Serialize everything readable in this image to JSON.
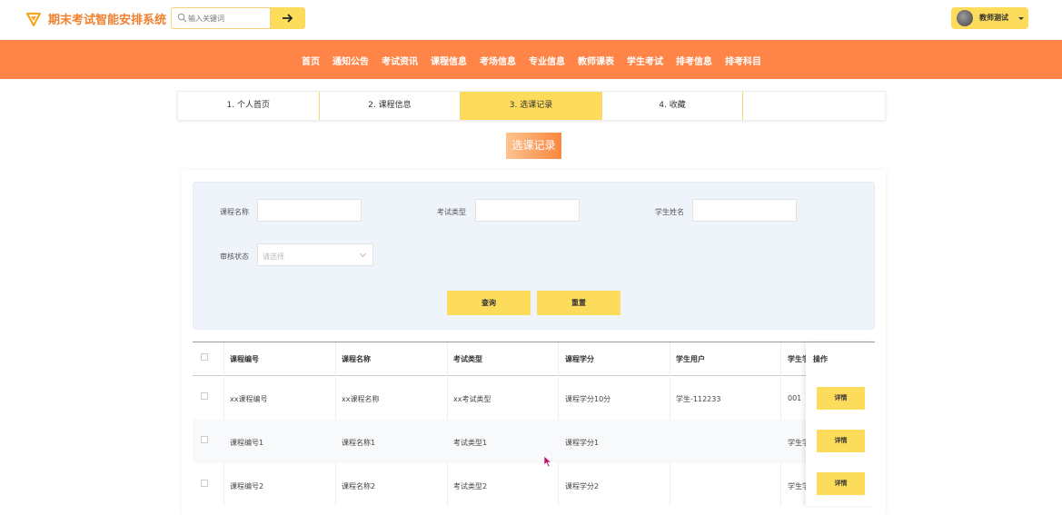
{
  "app": {
    "title": "期末考试智能安排系统"
  },
  "search": {
    "placeholder": "输入关键词"
  },
  "user": {
    "name": "教师测试"
  },
  "nav": {
    "items": [
      "首页",
      "通知公告",
      "考试资讯",
      "课程信息",
      "考场信息",
      "专业信息",
      "教师课表",
      "学生考试",
      "排考信息",
      "排考科目"
    ]
  },
  "steps": [
    {
      "label": "1. 个人首页"
    },
    {
      "label": "2. 课程信息"
    },
    {
      "label": "3. 选课记录"
    },
    {
      "label": "4. 收藏"
    },
    {
      "label": ""
    }
  ],
  "section": {
    "title": "选课记录"
  },
  "filter": {
    "course_name_label": "课程名称",
    "exam_type_label": "考试类型",
    "student_name_label": "学生姓名",
    "review_status_label": "审核状态",
    "review_status_placeholder": "请选择",
    "query_button": "查询",
    "reset_button": "重置"
  },
  "table": {
    "headers": [
      "课程编号",
      "课程名称",
      "考试类型",
      "课程学分",
      "学生用户",
      "学生学",
      "操作"
    ],
    "rows": [
      {
        "code": "xx课程编号",
        "name": "xx课程名称",
        "type": "xx考试类型",
        "credit": "课程学分10分",
        "user": "学生-112233",
        "sno": "001",
        "action": "详情"
      },
      {
        "code": "课程编号1",
        "name": "课程名称1",
        "type": "考试类型1",
        "credit": "课程学分1",
        "user": "",
        "sno": "学生学",
        "action": "详情"
      },
      {
        "code": "课程编号2",
        "name": "课程名称2",
        "type": "考试类型2",
        "credit": "课程学分2",
        "user": "",
        "sno": "学生学",
        "action": "详情"
      }
    ]
  },
  "colors": {
    "accent": "#ff8447",
    "yellow": "#fddc5c",
    "title": "#f08030"
  }
}
